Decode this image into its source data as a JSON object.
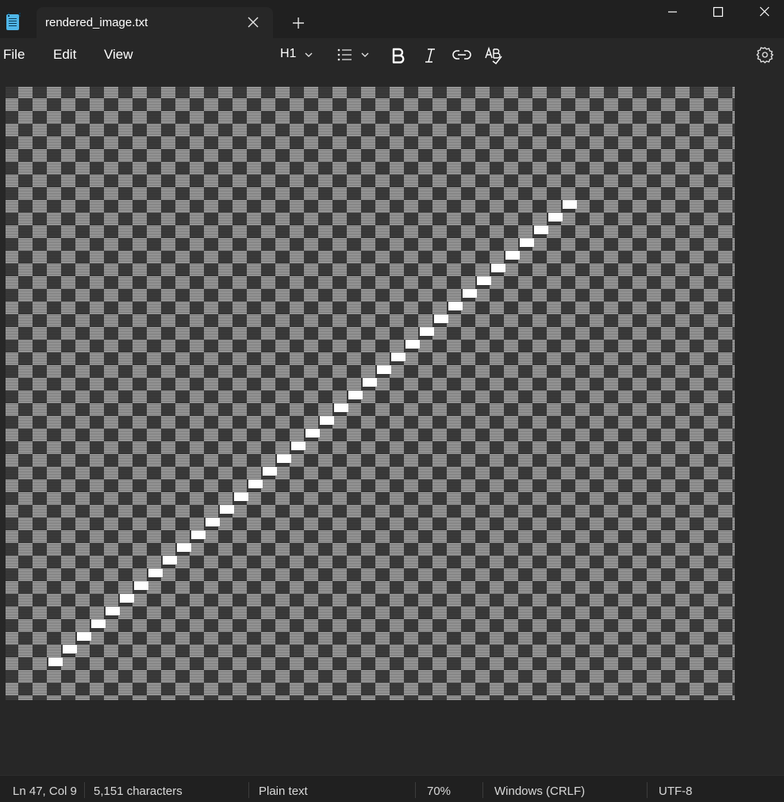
{
  "window": {
    "tab_title": "rendered_image.txt",
    "controls": {
      "minimize": "minimize-icon",
      "maximize": "maximize-icon",
      "close": "close-icon"
    }
  },
  "menu": {
    "file": "File",
    "edit": "Edit",
    "view": "View"
  },
  "toolbar": {
    "heading_label": "H1",
    "icons": [
      "chevron-down-icon",
      "bulleted-list-icon",
      "bold-icon",
      "italic-icon",
      "link-icon",
      "spellcheck-icon",
      "settings-icon"
    ]
  },
  "document": {
    "content_description_icon": "ascii-art-text",
    "diagonal_cells": 37
  },
  "status": {
    "position": "Ln 47, Col 9",
    "characters": "5,151 characters",
    "format": "Plain text",
    "zoom": "70%",
    "line_endings": "Windows (CRLF)",
    "encoding": "UTF-8"
  },
  "colors": {
    "titlebar_bg": "#202020",
    "editor_bg": "#272727",
    "app_icon": "#4fb6e8",
    "highlight_cell": "#ffffff"
  }
}
